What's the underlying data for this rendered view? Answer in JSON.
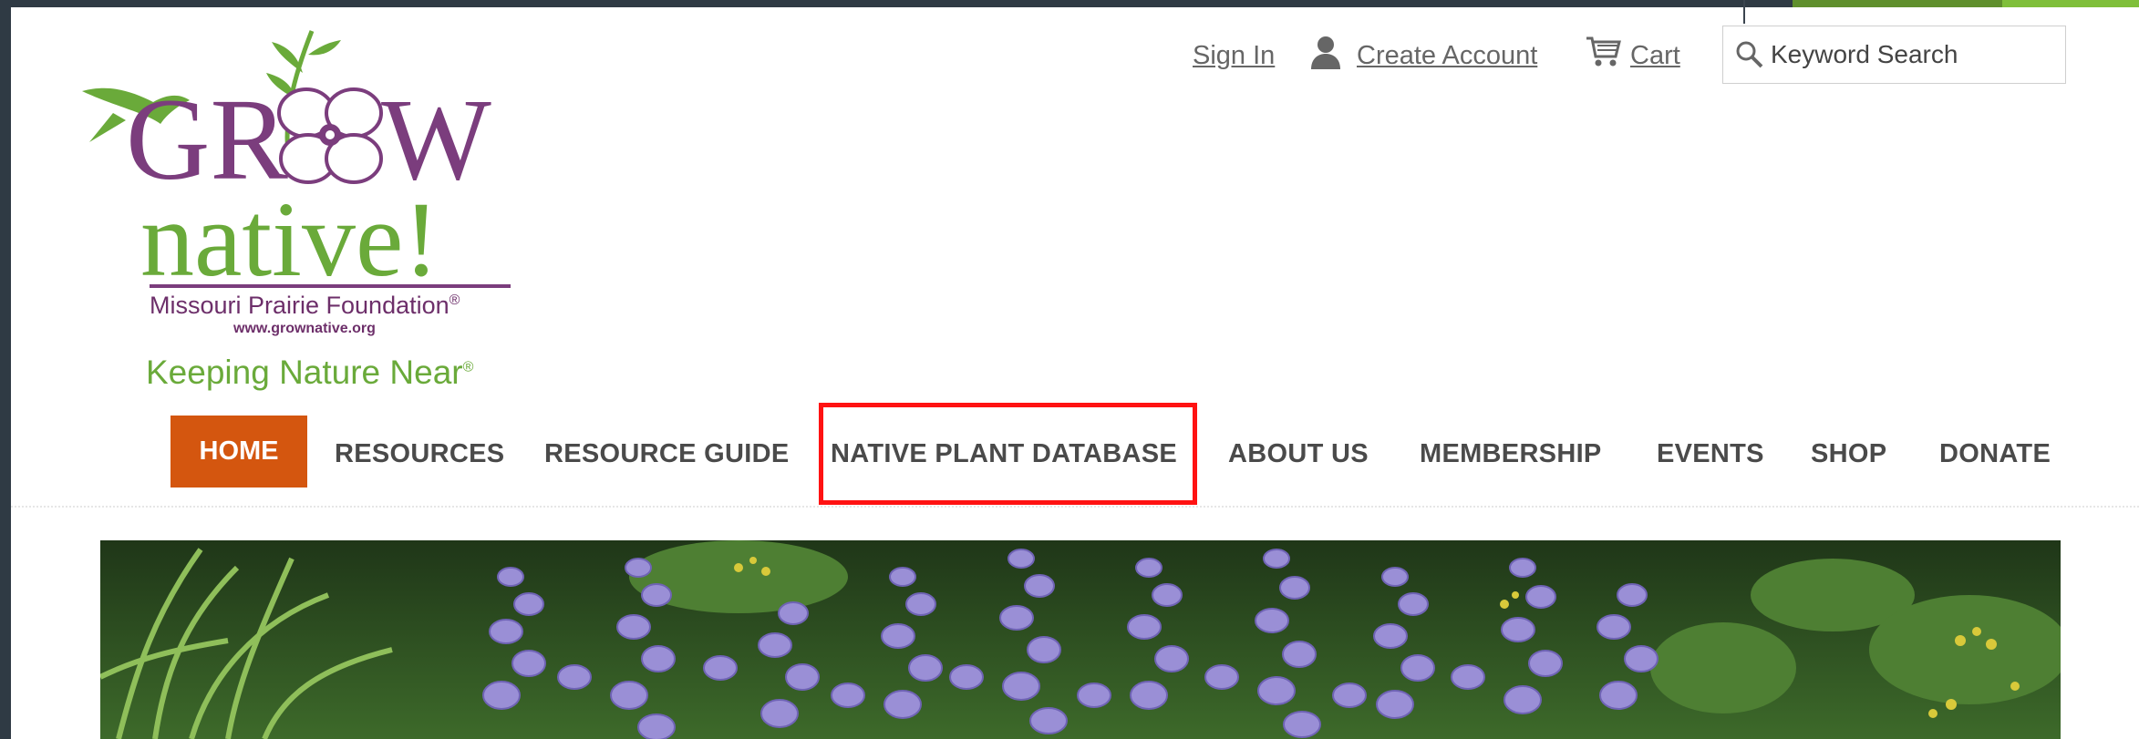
{
  "logo": {
    "foundation": "Missouri Prairie Foundation",
    "reg": "®",
    "url": "www.grownative.org",
    "tagline": "Keeping Nature Near",
    "colors": {
      "purple": "#7b3d7d",
      "green": "#6aaa3a",
      "foundation": "#6d2f6a"
    }
  },
  "utility": {
    "sign_in": "Sign In",
    "create_account": "Create Account",
    "cart": "Cart",
    "search_placeholder": "Keyword Search",
    "icons": {
      "account": "person-icon",
      "cart": "cart-icon",
      "search": "search-icon"
    }
  },
  "nav": {
    "items": [
      "HOME",
      "RESOURCES",
      "RESOURCE GUIDE",
      "NATIVE PLANT DATABASE",
      "ABOUT US",
      "MEMBERSHIP",
      "EVENTS",
      "SHOP",
      "DONATE"
    ],
    "active": "HOME",
    "highlighted": "NATIVE PLANT DATABASE",
    "colors": {
      "active_bg": "#d4560f",
      "highlight_border": "#ff1212",
      "text": "#4a4a4a"
    }
  },
  "hero": {
    "colors": {
      "foliage": "#2d4a20",
      "flower": "#9a8fd6",
      "accent": "#d8c93a"
    }
  }
}
